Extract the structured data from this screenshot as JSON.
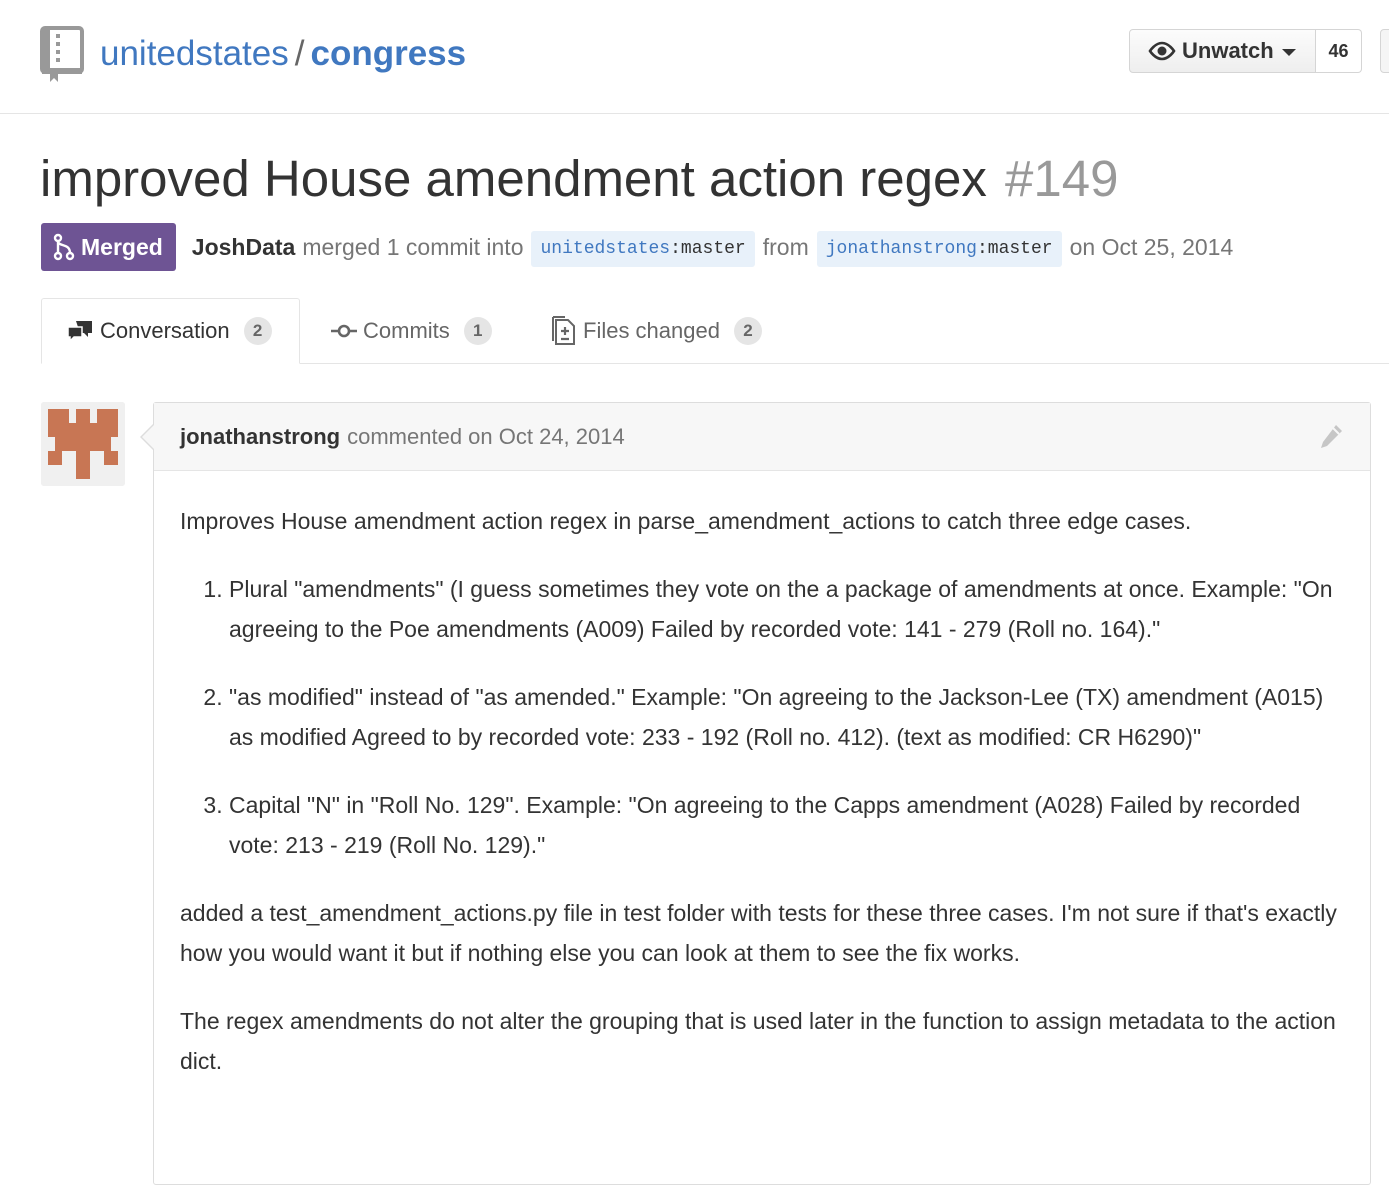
{
  "repo": {
    "owner": "unitedstates",
    "separator": "/",
    "name": "congress",
    "watch_label": "Unwatch",
    "watch_count": "46"
  },
  "pull_request": {
    "title": "improved House amendment action regex",
    "number": "#149",
    "state": "Merged",
    "author": "JoshData",
    "action_text": "merged 1 commit into",
    "base_owner": "unitedstates",
    "base_branch": "master",
    "from_text": "from",
    "head_owner": "jonathanstrong",
    "head_branch": "master",
    "date_text": "on Oct 25, 2014",
    "branch_colon": ":"
  },
  "tabs": [
    {
      "label": "Conversation",
      "count": "2"
    },
    {
      "label": "Commits",
      "count": "1"
    },
    {
      "label": "Files changed",
      "count": "2"
    }
  ],
  "comment": {
    "author": "jonathanstrong",
    "meta": "commented on Oct 24, 2014",
    "intro": "Improves House amendment action regex in parse_amendment_actions to catch three edge cases.",
    "items": [
      "Plural \"amendments\" (I guess sometimes they vote on the a package of amendments at once. Example: \"On agreeing to the Poe amendments (A009) Failed by recorded vote: 141 - 279 (Roll no. 164).\"",
      "\"as modified\" instead of \"as amended.\" Example: \"On agreeing to the Jackson-Lee (TX) amendment (A015) as modified Agreed to by recorded vote: 233 - 192 (Roll no. 412). (text as modified: CR H6290)\"",
      "Capital \"N\" in \"Roll No. 129\". Example: \"On agreeing to the Capps amendment (A028) Failed by recorded vote: 213 - 219 (Roll No. 129).\""
    ],
    "para2": "added a test_amendment_actions.py file in test folder with tests for these three cases. I'm not sure if that's exactly how you would want it but if nothing else you can look at them to see the fix works.",
    "para3": "The regex amendments do not alter the grouping that is used later in the function to assign metadata to the action dict."
  },
  "colors": {
    "link": "#4078c0",
    "merged": "#6e5494",
    "avatar": "#c87654"
  }
}
